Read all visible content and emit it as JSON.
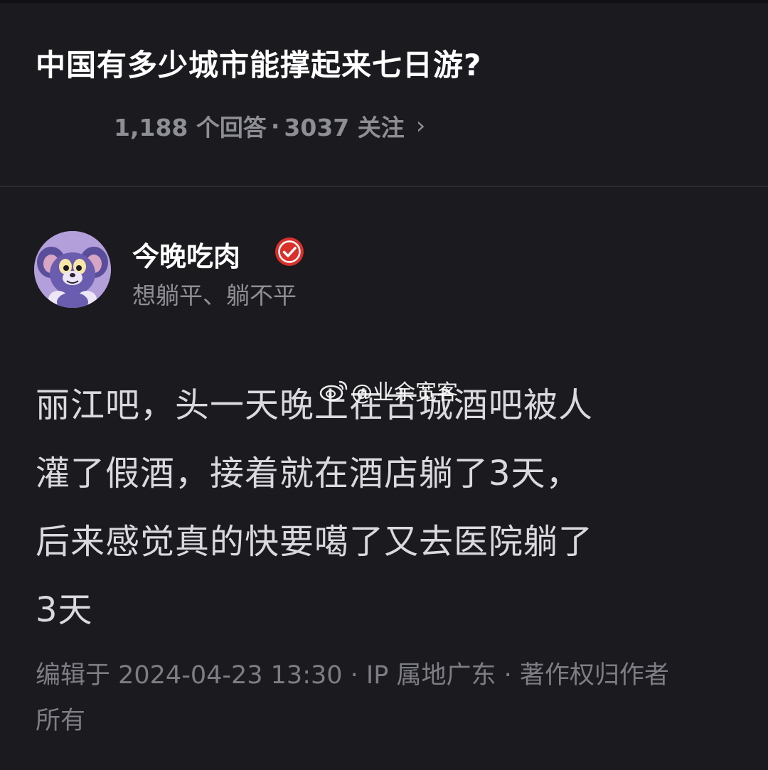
{
  "question": {
    "title": "中国有多少城市能撑起来七日游?",
    "answer_count": "1,188 个回答",
    "separator": "·",
    "follow_count": "3037 关注",
    "chevron": "›"
  },
  "author": {
    "name": "今晚吃肉",
    "bio": "想躺平、躺不平",
    "avatar_icon": "cartoon-cat-avatar-icon",
    "badge_icon": "verified-check-icon",
    "badge_color": "#d9302c"
  },
  "answer": {
    "lines": [
      "丽江吧，头一天晚上在古城酒吧被人",
      "灌了假酒，接着就在酒店躺了3天，",
      "后来感觉真的快要噶了又去医院躺了",
      "3天"
    ]
  },
  "footer": {
    "line1": "编辑于 2024-04-23 13:30 · IP 属地广东 · 著作权归作者",
    "line2": "所有"
  },
  "watermark": {
    "icon": "weibo-icon",
    "text": "@业余宽客"
  }
}
